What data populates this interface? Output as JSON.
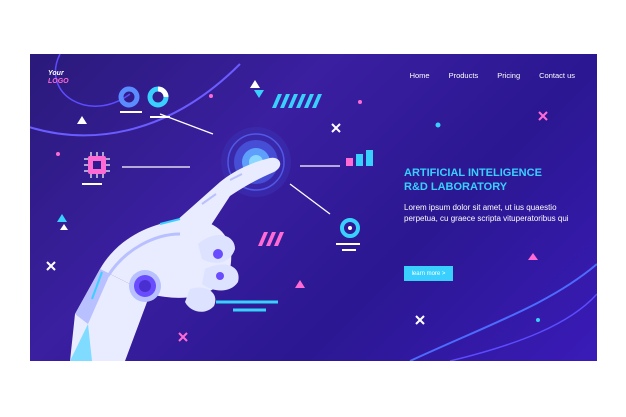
{
  "logo": {
    "line1": "Your",
    "line2": "LOGO"
  },
  "nav": {
    "home": "Home",
    "products": "Products",
    "pricing": "Pricing",
    "contact": "Contact us"
  },
  "hero": {
    "headline_line1": "ARTIFICIAL INTELIGENCE",
    "headline_line2": "R&D LABORATORY",
    "body": "Lorem ipsum dolor sit amet, ut ius quaestio perpetua, cu graece scripta vituperatoribus qui",
    "cta_label": "learn more >"
  },
  "colors": {
    "background": "#2e1b8f",
    "accent_cyan": "#39d0ff",
    "accent_pink": "#ff6ad5",
    "robot_white": "#e9ecff"
  }
}
